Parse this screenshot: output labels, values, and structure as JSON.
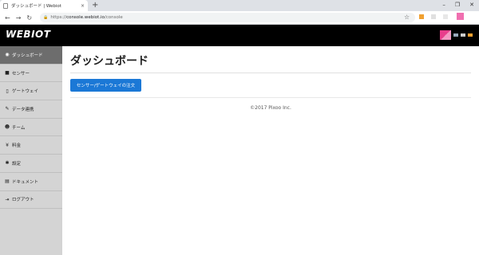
{
  "browser": {
    "tab_title": "ダッシュボード | Webiot",
    "tab_close": "×",
    "new_tab": "+",
    "url_scheme": "https://",
    "url_host": "console.webiot.io",
    "url_path": "/console",
    "window_controls": [
      "–",
      "❐",
      "✕"
    ],
    "extension_colors": [
      "#f0a030",
      "#e0e0e0",
      "#e8e8e8",
      "#f06fb0"
    ]
  },
  "header": {
    "logo": "WEBIOT",
    "avatar_colors": [
      "#e83e8c",
      "#f39ac3"
    ]
  },
  "sidebar": {
    "items": [
      {
        "icon": "dashboard-icon",
        "glyph": "◉",
        "label": "ダッシュボード",
        "active": true
      },
      {
        "icon": "sensor-icon",
        "glyph": "■",
        "label": "センサー",
        "active": false
      },
      {
        "icon": "gateway-icon",
        "glyph": "▯",
        "label": "ゲートウェイ",
        "active": false
      },
      {
        "icon": "data-link-icon",
        "glyph": "✎",
        "label": "データ連携",
        "active": false
      },
      {
        "icon": "team-icon",
        "glyph": "☻",
        "label": "チーム",
        "active": false
      },
      {
        "icon": "yen-icon",
        "glyph": "¥",
        "label": "料金",
        "active": false
      },
      {
        "icon": "gear-icon",
        "glyph": "✱",
        "label": "設定",
        "active": false
      },
      {
        "icon": "document-icon",
        "glyph": "▤",
        "label": "ドキュメント",
        "active": false
      },
      {
        "icon": "logout-icon",
        "glyph": "⇥",
        "label": "ログアウト",
        "active": false
      }
    ]
  },
  "main": {
    "title": "ダッシュボード",
    "order_button": "センサー/ゲートウェイの注文",
    "copyright": "©2017 Pixoo Inc."
  },
  "colors": {
    "header_bg": "#000000",
    "sidebar_bg": "#d4d4d4",
    "sidebar_active": "#6d6d6d",
    "button_primary": "#1b78d6"
  }
}
